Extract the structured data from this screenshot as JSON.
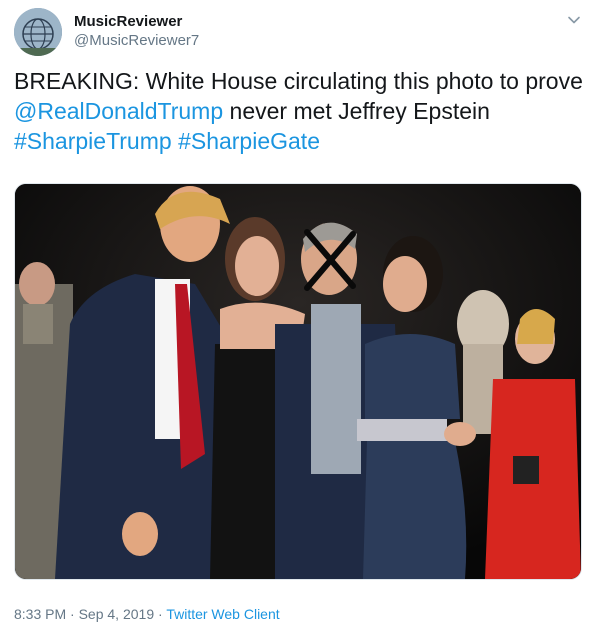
{
  "author": {
    "display_name": "MusicReviewer",
    "handle": "@MusicReviewer7",
    "avatar_icon": "globe-sculpture-avatar"
  },
  "tweet": {
    "text_prefix": "BREAKING: White House circulating this photo to prove ",
    "mention": "@RealDonaldTrump",
    "text_middle": " never met Jeffrey Epstein ",
    "hashtag1": "#SharpieTrump",
    "hashtag_sep": " ",
    "hashtag2": "#SharpieGate"
  },
  "media": {
    "description_icon": "photo-with-sharpie-x"
  },
  "meta": {
    "time": "8:33 PM",
    "separator1": " · ",
    "date": "Sep 4, 2019",
    "separator2": " · ",
    "client": "Twitter Web Client"
  },
  "colors": {
    "link": "#1b95e0",
    "secondary": "#657786",
    "primary": "#14171a"
  },
  "icons": {
    "caret": "chevron-down-icon"
  }
}
